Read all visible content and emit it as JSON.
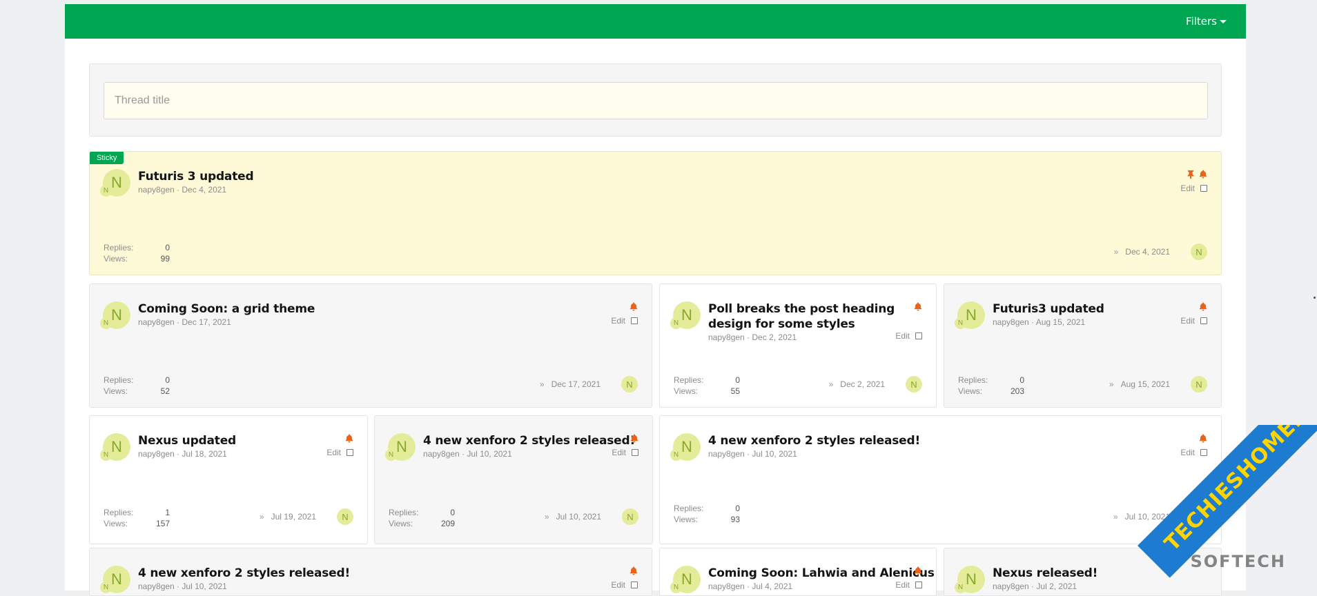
{
  "header": {
    "filters_label": "Filters"
  },
  "search": {
    "placeholder": "Thread title"
  },
  "labels": {
    "sticky": "Sticky",
    "edit": "Edit",
    "replies": "Replies:",
    "views": "Views:",
    "arrow": "»"
  },
  "colors": {
    "brand_green": "#00a651",
    "sticky_bg": "#fefad8",
    "bell": "#e8641b",
    "avatar_bg": "#e4ec9a"
  },
  "threads": [
    {
      "title": "Futuris 3 updated",
      "author": "napy8gen",
      "date": "Dec 4, 2021",
      "replies": "0",
      "views": "99",
      "last_date": "Dec 4, 2021",
      "avatar": "N",
      "sticky": true
    },
    {
      "title": "Coming Soon: a grid theme",
      "author": "napy8gen",
      "date": "Dec 17, 2021",
      "replies": "0",
      "views": "52",
      "last_date": "Dec 17, 2021",
      "avatar": "N"
    },
    {
      "title": "Poll breaks the post heading design for some styles",
      "author": "napy8gen",
      "date": "Dec 2, 2021",
      "replies": "0",
      "views": "55",
      "last_date": "Dec 2, 2021",
      "avatar": "N"
    },
    {
      "title": "Futuris3 updated",
      "author": "napy8gen",
      "date": "Aug 15, 2021",
      "replies": "0",
      "views": "203",
      "last_date": "Aug 15, 2021",
      "avatar": "N"
    },
    {
      "title": "Nexus updated",
      "author": "napy8gen",
      "date": "Jul 18, 2021",
      "replies": "1",
      "views": "157",
      "last_date": "Jul 19, 2021",
      "avatar": "N"
    },
    {
      "title": "4 new xenforo 2 styles released!",
      "author": "napy8gen",
      "date": "Jul 10, 2021",
      "replies": "0",
      "views": "209",
      "last_date": "Jul 10, 2021",
      "avatar": "N"
    },
    {
      "title": "4 new xenforo 2 styles released!",
      "author": "napy8gen",
      "date": "Jul 10, 2021",
      "replies": "0",
      "views": "93",
      "last_date": "Jul 10, 2021",
      "avatar": "N"
    },
    {
      "title": "4 new xenforo 2 styles released!",
      "author": "napy8gen",
      "date": "Jul 10, 2021",
      "avatar": "N"
    },
    {
      "title": "Coming Soon: Lahwia and Alenicus",
      "author": "napy8gen",
      "date": "Jul 4, 2021",
      "avatar": "N"
    },
    {
      "title": "Nexus released!",
      "author": "napy8gen",
      "date": "Jul 2, 2021",
      "avatar": "N"
    }
  ],
  "watermark": {
    "brand": "TECHIESHOME.COM",
    "sub": "SOFTECH"
  }
}
